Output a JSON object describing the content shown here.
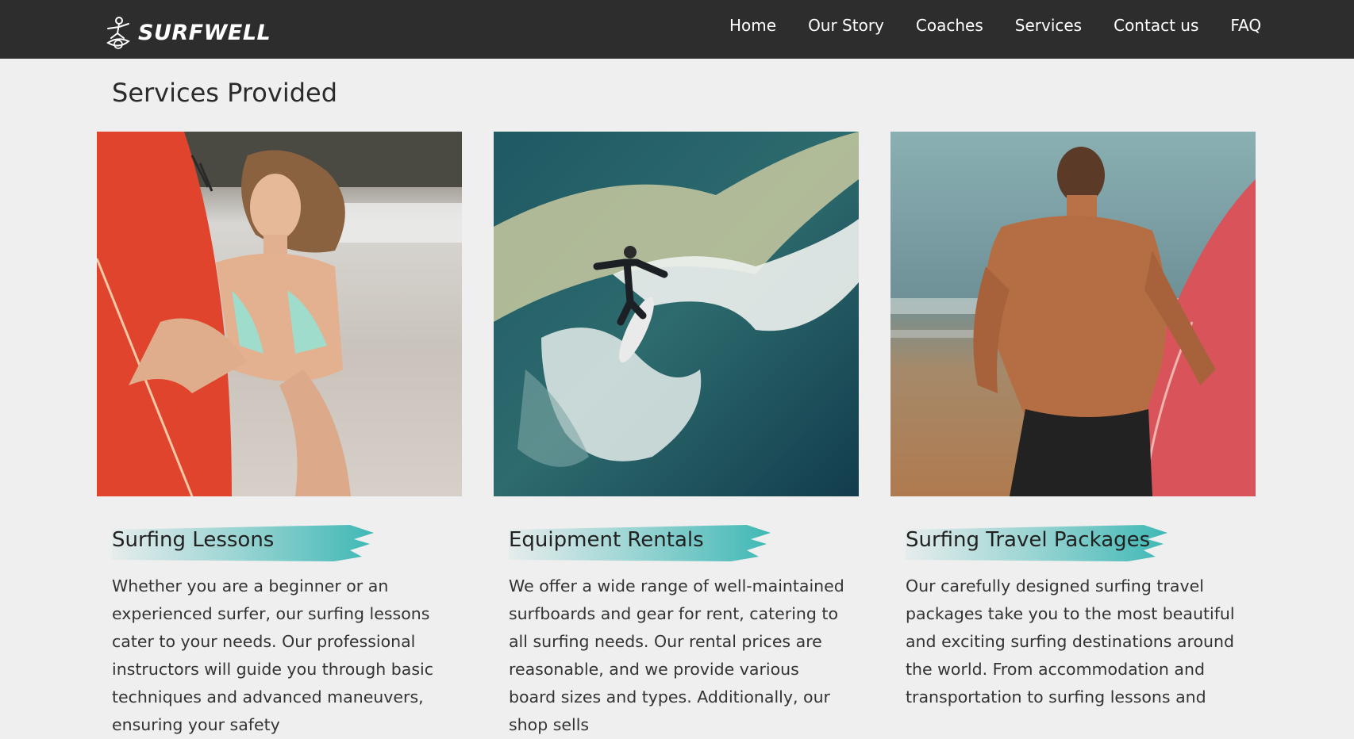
{
  "brand": {
    "logo_text": "SURFWELL",
    "logo_icon": "surfer-logo-icon"
  },
  "nav": {
    "items": [
      {
        "label": "Home"
      },
      {
        "label": "Our Story"
      },
      {
        "label": "Coaches"
      },
      {
        "label": "Services"
      },
      {
        "label": "Contact us"
      },
      {
        "label": "FAQ"
      }
    ]
  },
  "page": {
    "title": "Services Provided"
  },
  "services": [
    {
      "title": "Surfing Lessons",
      "image": "woman-holding-red-surfboard-photo",
      "description": "Whether you are a beginner or an experienced surfer, our surfing lessons cater to your needs. Our professional instructors will guide you through basic techniques and advanced maneuvers, ensuring your safety"
    },
    {
      "title": "Equipment Rentals",
      "image": "surfer-riding-wave-photo",
      "description": "We offer a wide range of well-maintained surfboards and gear for rent, catering to all surfing needs. Our rental prices are reasonable, and we provide various board sizes and types. Additionally, our shop sells"
    },
    {
      "title": "Surfing Travel Packages",
      "image": "man-carrying-surfboard-photo",
      "description": "Our carefully designed surfing travel packages take you to the most beautiful and exciting surfing destinations around the world. From accommodation and transportation to surfing lessons and"
    }
  ],
  "colors": {
    "navbar_bg": "#2d2d2d",
    "page_bg": "#efefef",
    "brush_accent": "#3fb8b5"
  }
}
